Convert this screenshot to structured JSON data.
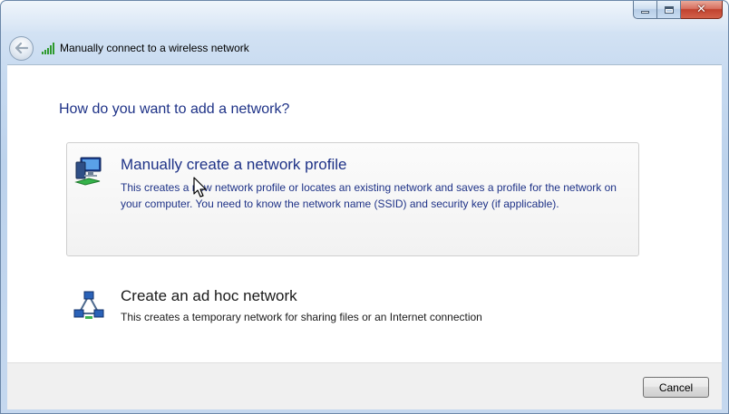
{
  "window": {
    "title": "Manually connect to a wireless network",
    "caption_buttons": {
      "minimize": "minimize-icon",
      "maximize": "maximize-icon",
      "close": "close-icon"
    }
  },
  "nav": {
    "back_icon": "back-arrow-icon",
    "network_icon": "wireless-signal-icon"
  },
  "content": {
    "heading": "How do you want to add a network?",
    "options": [
      {
        "title": "Manually create a network profile",
        "description": "This creates a new network profile or locates an existing network and saves a profile for the network on your computer. You need to know the network name (SSID) and security key (if applicable).",
        "icon": "network-profile-icon",
        "state": "hover"
      },
      {
        "title": "Create an ad hoc network",
        "description": "This creates a temporary network for sharing files or an Internet connection",
        "icon": "ad-hoc-network-icon",
        "state": "normal"
      }
    ]
  },
  "footer": {
    "cancel_label": "Cancel"
  },
  "colors": {
    "link_blue": "#1e3287",
    "frame_blue": "#c7daf0",
    "close_red": "#c0422e",
    "signal_green": "#2e9a2e"
  }
}
